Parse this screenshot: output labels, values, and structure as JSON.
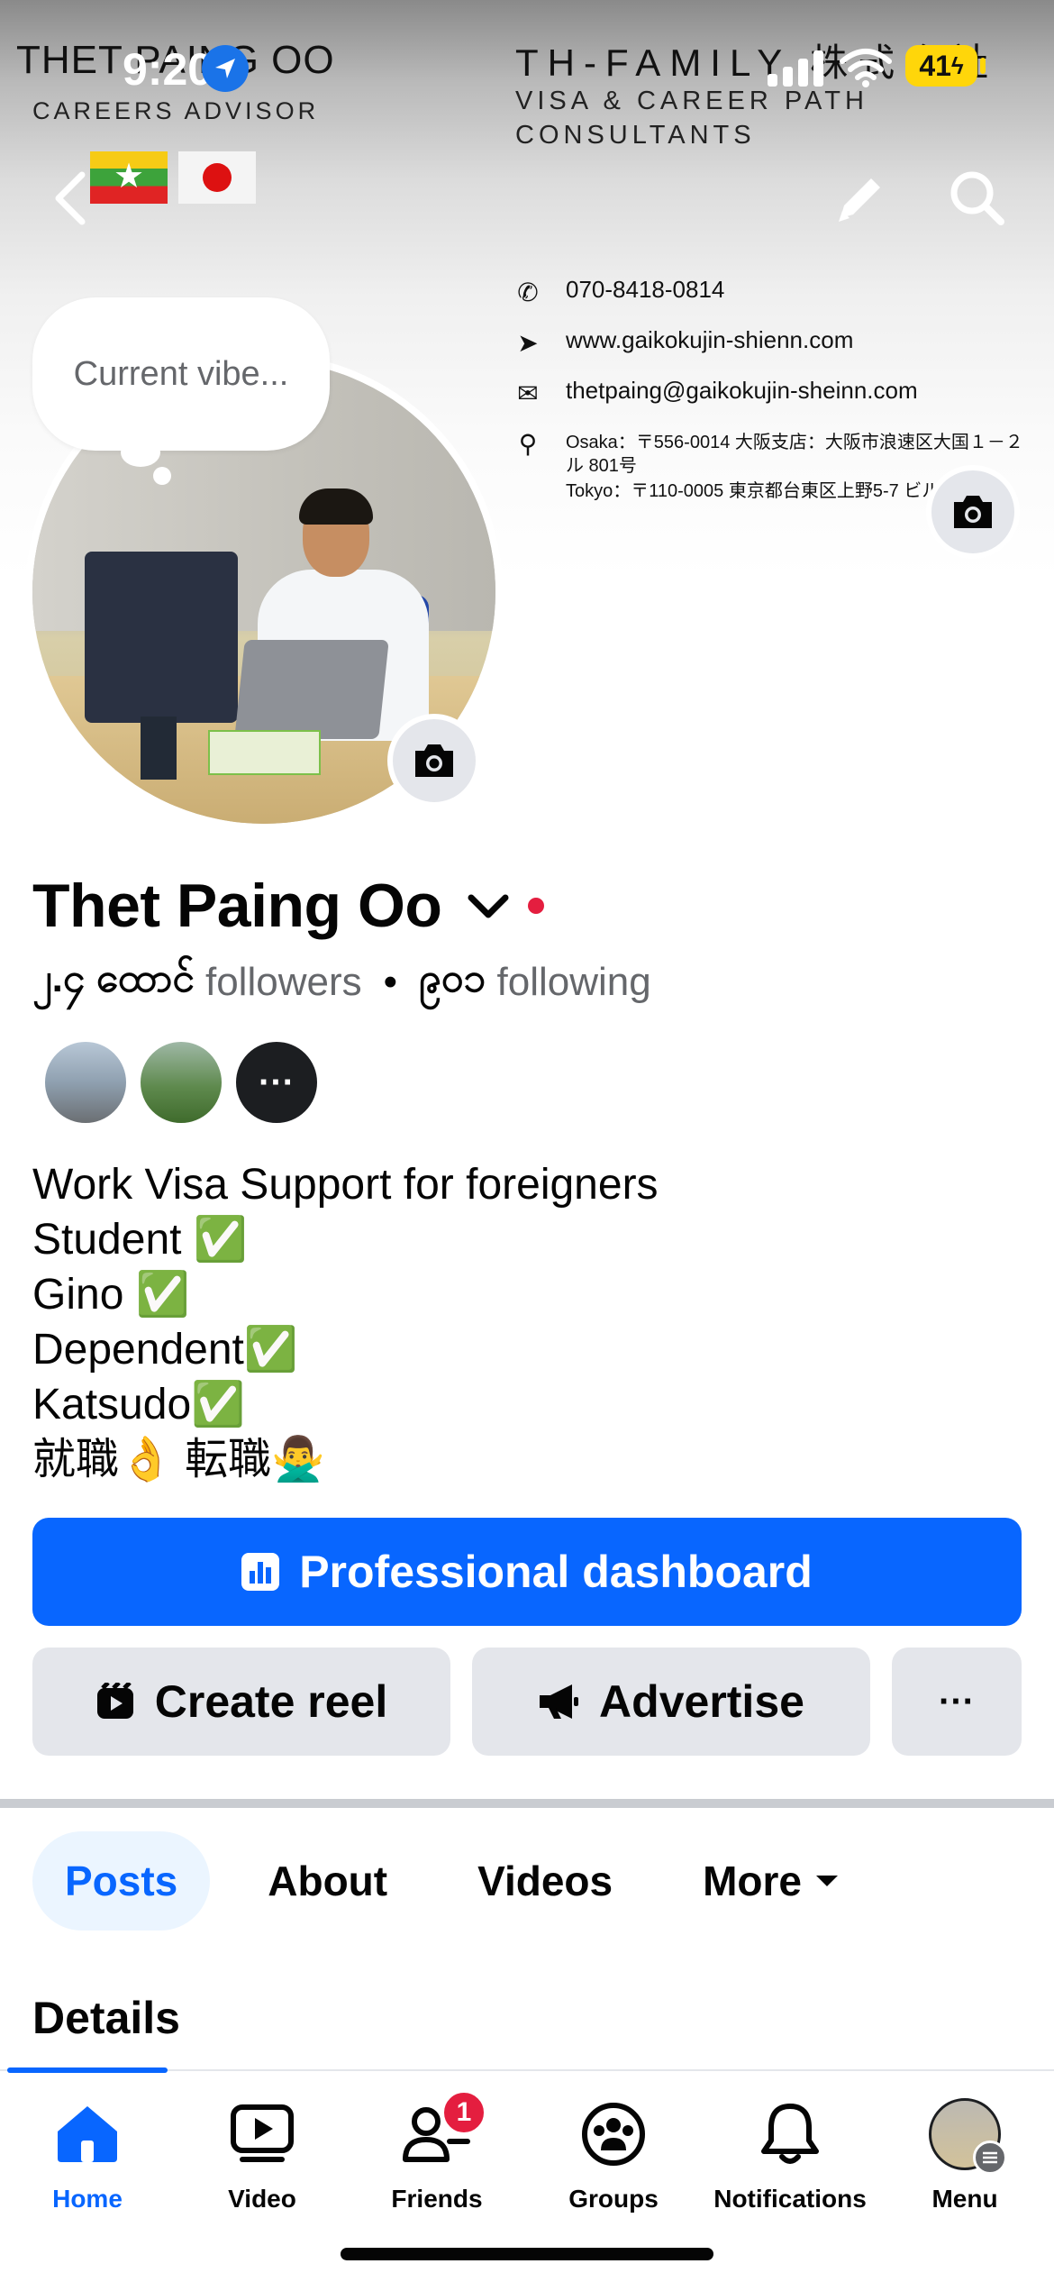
{
  "status_bar": {
    "time": "9:20",
    "battery": "41"
  },
  "cover": {
    "brand": "THET PAING OO",
    "brand_subtitle": "CAREERS ADVISOR",
    "company": "TH-FAMILY 株式会社",
    "company_tagline_1": "VISA & CAREER PATH",
    "company_tagline_2": "CONSULTANTS",
    "phone": "070-8418-0814",
    "website": "www.gaikokujin-shienn.com",
    "email": "thetpaing@gaikokujin-sheinn.com",
    "address_osaka": "Osaka：〒556-0014 大阪支店：大阪市浪速区大国１－２",
    "address_osaka_2": "ル 801号",
    "address_tokyo": "Tokyo：〒110-0005 東京都台東区上野5-7 ビル"
  },
  "profile": {
    "vibe_placeholder": "Current vibe...",
    "name": "Thet Paing Oo",
    "followers_count": "၂.၄ ထောင်",
    "followers_label": "followers",
    "separator": "•",
    "following_count": "၉၀၁",
    "following_label": "following",
    "friends_more": "···",
    "bio": [
      "Work Visa Support for foreigners",
      "Student ✅",
      "Gino  ✅",
      "Dependent✅",
      "Katsudo✅",
      "就職👌  転職🙅‍♂️"
    ]
  },
  "actions": {
    "professional_dashboard": "Professional dashboard",
    "create_reel": "Create reel",
    "advertise": "Advertise",
    "more": "···"
  },
  "tabs": [
    {
      "label": "Posts",
      "active": true
    },
    {
      "label": "About",
      "active": false
    },
    {
      "label": "Videos",
      "active": false
    },
    {
      "label": "More",
      "active": false
    }
  ],
  "section_title": "Details",
  "bottom_nav": [
    {
      "label": "Home",
      "icon": "home-icon",
      "active": true
    },
    {
      "label": "Video",
      "icon": "video-icon",
      "active": false
    },
    {
      "label": "Friends",
      "icon": "friends-icon",
      "active": false,
      "badge": "1"
    },
    {
      "label": "Groups",
      "icon": "groups-icon",
      "active": false
    },
    {
      "label": "Notifications",
      "icon": "bell-icon",
      "active": false
    },
    {
      "label": "Menu",
      "icon": "menu-avatar",
      "active": false
    }
  ],
  "colors": {
    "primary": "#0866ff",
    "secondary_button": "#e4e6eb",
    "active_tab_bg": "#ebf5ff",
    "badge": "#e41e3f",
    "muted_text": "#65676b"
  }
}
